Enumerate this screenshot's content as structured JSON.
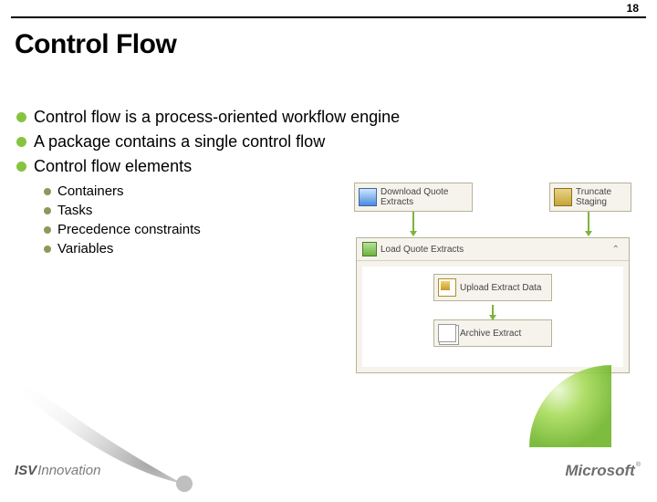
{
  "page_number": "18",
  "title": "Control Flow",
  "bullets": [
    "Control flow is a process-oriented workflow engine",
    "A package contains a single control flow",
    "Control flow elements"
  ],
  "sub_bullets": [
    "Containers",
    "Tasks",
    "Precedence constraints",
    "Variables"
  ],
  "diagram": {
    "box1": "Download Quote Extracts",
    "box2": "Truncate Staging",
    "container_header": "Load Quote Extracts",
    "inner1": "Upload Extract Data",
    "inner2": "Archive Extract"
  },
  "footer": {
    "isv_brand_strong": "ISV",
    "isv_brand_light": "Innovation",
    "ms": "Microsoft",
    "reg": "®"
  }
}
